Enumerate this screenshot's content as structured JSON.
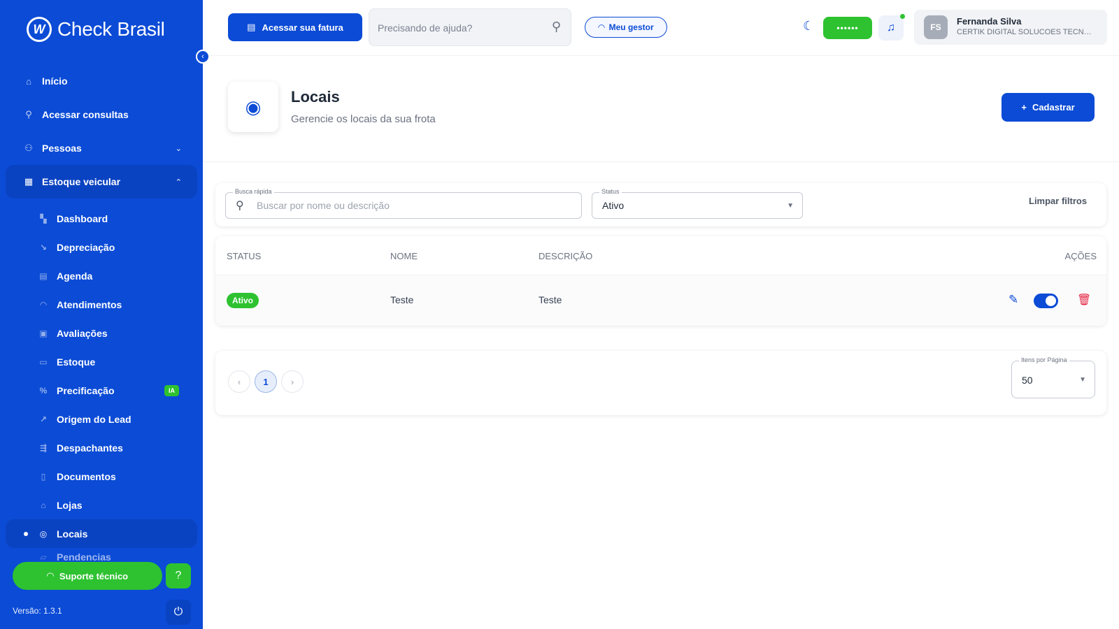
{
  "brand": {
    "name": "Check Brasil"
  },
  "sidebar": {
    "items": [
      {
        "label": "Início",
        "icon": "home-icon"
      },
      {
        "label": "Acessar consultas",
        "icon": "search-icon"
      },
      {
        "label": "Pessoas",
        "icon": "users-icon"
      },
      {
        "label": "Estoque veicular",
        "icon": "building-icon"
      }
    ],
    "subitems": [
      {
        "label": "Dashboard"
      },
      {
        "label": "Depreciação"
      },
      {
        "label": "Agenda"
      },
      {
        "label": "Atendimentos"
      },
      {
        "label": "Avaliações"
      },
      {
        "label": "Estoque"
      },
      {
        "label": "Precificação",
        "badge": "IA"
      },
      {
        "label": "Origem do Lead"
      },
      {
        "label": "Despachantes"
      },
      {
        "label": "Documentos"
      },
      {
        "label": "Lojas"
      },
      {
        "label": "Locais"
      },
      {
        "label": "Pendencias"
      }
    ],
    "support_label": "Suporte técnico",
    "version": "Versão: 1.3.1"
  },
  "topbar": {
    "invoice_label": "Acessar sua fatura",
    "help_placeholder": "Precisando de ajuda?",
    "manager_label": "Meu gestor",
    "masked_value": "••••••",
    "user": {
      "initials": "FS",
      "name": "Fernanda Silva",
      "company": "CERTIK DIGITAL SOLUCOES TECNOLOGIA"
    }
  },
  "page": {
    "title": "Locais",
    "subtitle": "Gerencie os locais da sua frota",
    "register_label": "Cadastrar"
  },
  "filters": {
    "quick_label": "Busca rápida",
    "quick_placeholder": "Buscar por nome ou descrição",
    "status_label": "Status",
    "status_value": "Ativo",
    "clear_label": "Limpar filtros"
  },
  "table": {
    "headers": {
      "status": "STATUS",
      "name": "NOME",
      "description": "DESCRIÇÃO",
      "actions": "AÇÕES"
    },
    "rows": [
      {
        "status": "Ativo",
        "name": "Teste",
        "description": "Teste",
        "enabled": true
      }
    ]
  },
  "pagination": {
    "current_page": "1",
    "per_page_label": "Itens por Página",
    "per_page_value": "50"
  },
  "colors": {
    "primary": "#0b4bd6",
    "success": "#2ec230",
    "danger": "#e5203f"
  }
}
